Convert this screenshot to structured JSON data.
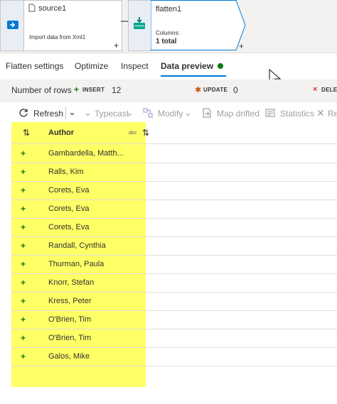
{
  "pipeline": {
    "source": {
      "title": "source1",
      "subtitle": "Import data from Xml1",
      "plus": "+"
    },
    "flatten": {
      "title": "flatten1",
      "columns_label": "Columns:",
      "columns_value": "1 total",
      "plus": "+"
    }
  },
  "tabs": [
    {
      "label": "Flatten settings"
    },
    {
      "label": "Optimize"
    },
    {
      "label": "Inspect"
    },
    {
      "label": "Data preview"
    }
  ],
  "stats": {
    "rows_label": "Number of rows",
    "insert_label": "INSERT",
    "insert_count": "12",
    "update_label": "UPDATE",
    "update_count": "0",
    "delete_label": "DELE"
  },
  "toolbar": {
    "refresh": "Refresh",
    "typecast": "Typecast",
    "modify": "Modify",
    "map_drifted": "Map drifted",
    "statistics": "Statistics",
    "remove": "Re"
  },
  "grid": {
    "column_header": "Author",
    "column_type": "abc",
    "row_marker": "+",
    "rows": [
      "Gambardella, Matth...",
      "Ralls, Kim",
      "Corets, Eva",
      "Corets, Eva",
      "Corets, Eva",
      "Randall, Cynthia",
      "Thurman, Paula",
      "Knorr, Stefan",
      "Kress, Peter",
      "O'Brien, Tim",
      "O'Brien, Tim",
      "Galos, Mike"
    ]
  }
}
